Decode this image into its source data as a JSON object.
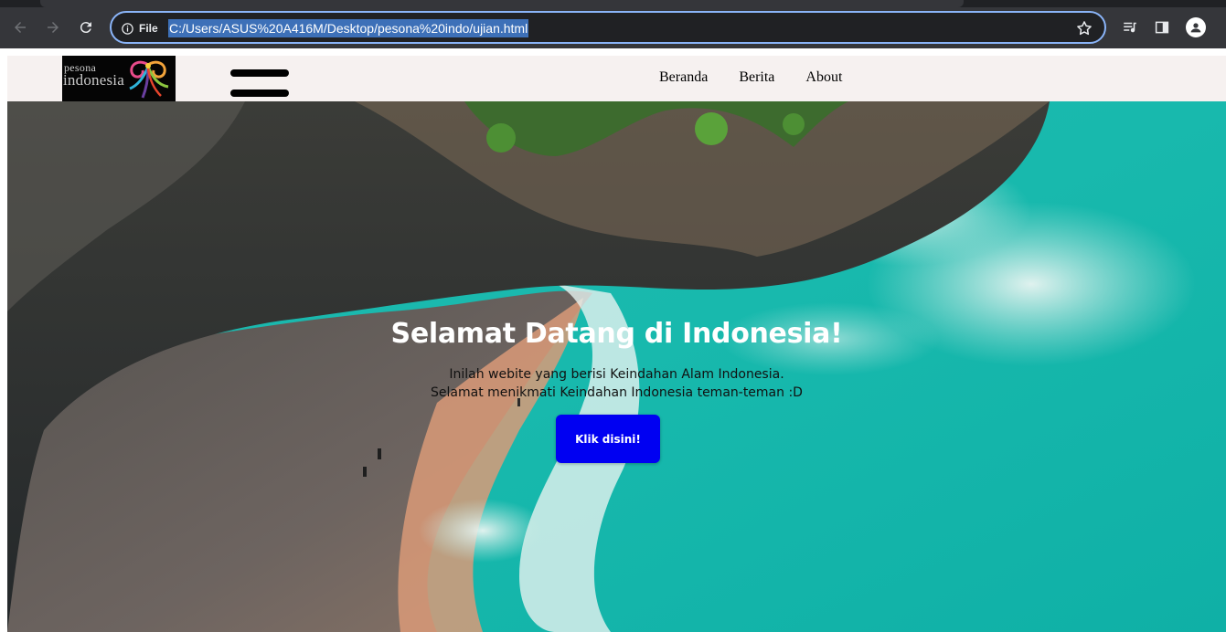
{
  "browser": {
    "site_info_label": "File",
    "url": "C:/Users/ASUS%20A416M/Desktop/pesona%20indo/ujian.html"
  },
  "navbar": {
    "logo": {
      "line1": "pesona",
      "line2": "indonesia"
    },
    "links": [
      {
        "label": "Beranda"
      },
      {
        "label": "Berita"
      },
      {
        "label": "About"
      }
    ]
  },
  "hero": {
    "title": "Selamat Datang di Indonesia!",
    "subtitle_line1": "Inilah webite yang berisi Keindahan Alam Indonesia.",
    "subtitle_line2": "Selamat menikmati Keindahan Indonesia teman-teman :D",
    "button_label": "Klik disini!",
    "button_color": "#0000f2"
  },
  "colors": {
    "navbar_bg": "#f6f1f0",
    "chrome_bg": "#35363a",
    "omnibox_border": "#8ab4f8"
  }
}
